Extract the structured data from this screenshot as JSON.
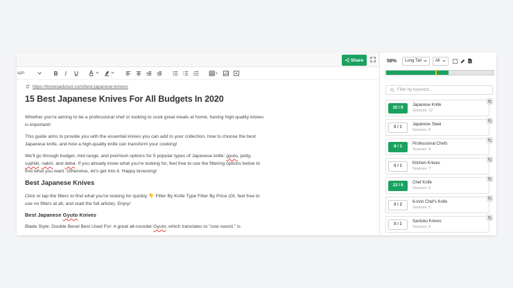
{
  "header": {
    "share_label": "Share"
  },
  "toolbar": {
    "paragraph_label": "aph"
  },
  "article": {
    "url": "https://knivesadvisor.com/best-japanese-knives/",
    "title": "15 Best Japanese Knives For All Budgets In 2020",
    "p1": "Whether you're aiming to be a professional chef or looking to cook great meals at home, having high-quality knives is important!",
    "p2": "This guide aims to provide you with the essential knives you can add to your collection, how to choose the best Japanese knife, and how a high-quality knife can transform your cooking!",
    "p3_a": "We'll go through budget, mid-range, and premium options for 5 popular types of Japanese knife: ",
    "p3_k1": "gyuto",
    "p3_c1": ", petty, ",
    "p3_k2": "sujihiki",
    "p3_c2": ", ",
    "p3_k3": "nakiri",
    "p3_c3": ", and ",
    "p3_k4": "deba",
    "p3_b": ". If you already know what you're looking for, feel free to use the filtering options below to find what you want. Otherwise, let's get into it. Happy browsing!",
    "h2": "Best Japanese Knives",
    "p4": "Click or tap the filters to find what you're looking for quickly 👇 Filter By Knife Type Filter By Price (Or, feel free to use no filters at all, and read the full article). Enjoy!",
    "h3_a": "Best Japanese ",
    "h3_k": "Gyuto",
    "h3_b": " Knives",
    "p5_a": "Blade Style: Double Bevel Best Used For: A great all-rounder ",
    "p5_k": "Gyuto",
    "p5_b": ", which translates to \"cow sword,\" is"
  },
  "side": {
    "score": "58%",
    "mode": "Long Tail",
    "scope": "All",
    "progress": 0.58,
    "marker": 0.46,
    "filter_placeholder": "Filter by keyword...",
    "keywords": [
      {
        "count": "10 / 9",
        "name": "Japanese Knife",
        "sources": "Sources: 12",
        "active": true
      },
      {
        "count": "0 / 1",
        "name": "Japanese Steel",
        "sources": "Sources: 8",
        "active": false
      },
      {
        "count": "8 / 1",
        "name": "Professional Chefs",
        "sources": "Sources: 8",
        "active": true
      },
      {
        "count": "0 / 1",
        "name": "Kitchen Knives",
        "sources": "Sources: 7",
        "active": false
      },
      {
        "count": "13 / 5",
        "name": "Chef Knife",
        "sources": "Sources: 6",
        "active": true
      },
      {
        "count": "0 / 2",
        "name": "8-inch Chef's Knife",
        "sources": "Sources: 5",
        "active": false
      },
      {
        "count": "0 / 1",
        "name": "Santoku Knives",
        "sources": "Sources: 5",
        "active": false
      }
    ]
  }
}
